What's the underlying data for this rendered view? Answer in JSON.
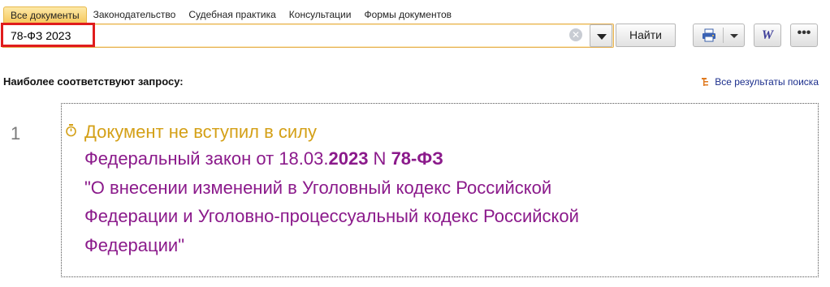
{
  "tabs": [
    {
      "label": "Все документы",
      "active": true
    },
    {
      "label": "Законодательство",
      "active": false
    },
    {
      "label": "Судебная практика",
      "active": false
    },
    {
      "label": "Консультации",
      "active": false
    },
    {
      "label": "Формы документов",
      "active": false
    }
  ],
  "search": {
    "value": "78-ФЗ 2023",
    "clear_symbol": "✕"
  },
  "toolbar": {
    "find_label": "Найти",
    "word_label": "W",
    "more_label": "•••"
  },
  "results_header": {
    "heading": "Наиболее соответствуют запросу:",
    "all_results_label": "Все результаты поиска"
  },
  "result": {
    "number": "1",
    "status": "Документ не вступил в силу",
    "title_parts": {
      "p1": "Федеральный закон от 18.03.",
      "p2": "2023",
      "p3": " N ",
      "p4": "78-ФЗ",
      "line2": "\"О внесении изменений в Уголовный кодекс Российской",
      "line3": "Федерации и Уголовно-процессуальный кодекс Российской",
      "line4": "Федерации\""
    }
  },
  "colors": {
    "accent": "#f6c75a",
    "status": "#d4a017",
    "title": "#8b1a8b",
    "link": "#1b2e8c",
    "highlight": "#e01c1c"
  },
  "icons": [
    "clear-icon",
    "chevron-down-icon",
    "printer-icon",
    "word-icon",
    "more-icon",
    "tree-icon",
    "clock-icon"
  ]
}
